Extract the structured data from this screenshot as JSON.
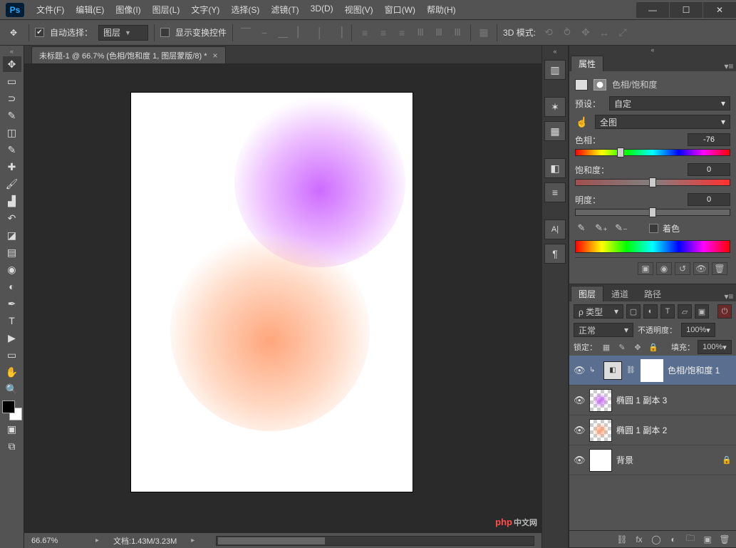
{
  "app": {
    "logo_text": "Ps"
  },
  "menu": {
    "file": "文件(F)",
    "edit": "编辑(E)",
    "image": "图像(I)",
    "layer": "图层(L)",
    "type": "文字(Y)",
    "select": "选择(S)",
    "filter": "滤镜(T)",
    "threeD": "3D(D)",
    "view": "视图(V)",
    "window": "窗口(W)",
    "help": "帮助(H)"
  },
  "options": {
    "auto_select_label": "自动选择：",
    "auto_select_target": "图层",
    "show_transform_label": "显示变换控件",
    "threeD_mode_label": "3D 模式:"
  },
  "document": {
    "tab_title": "未标题-1 @ 66.7% (色相/饱和度 1, 图层蒙版/8) *"
  },
  "status": {
    "zoom": "66.67%",
    "doc_info": "文档:1.43M/3.23M"
  },
  "properties": {
    "tab_label": "属性",
    "adjustment_name": "色相/饱和度",
    "preset_label": "预设：",
    "preset_value": "自定",
    "channel_value": "全图",
    "hue_label": "色相：",
    "hue_value": "-76",
    "sat_label": "饱和度：",
    "sat_value": "0",
    "light_label": "明度：",
    "light_value": "0",
    "colorize_label": "着色"
  },
  "layers_panel": {
    "tab_layers": "图层",
    "tab_channels": "通道",
    "tab_paths": "路径",
    "kind_label": "ρ 类型",
    "blend_mode": "正常",
    "opacity_label": "不透明度：",
    "opacity_value": "100%",
    "lock_label": "锁定：",
    "fill_label": "填充：",
    "fill_value": "100%",
    "layers": [
      {
        "name": "色相/饱和度 1",
        "type": "adjustment",
        "selected": true
      },
      {
        "name": "椭圆 1 副本 3",
        "type": "shape_purple"
      },
      {
        "name": "椭圆 1 副本 2",
        "type": "shape_orange"
      },
      {
        "name": "背景",
        "type": "background",
        "locked": true
      }
    ]
  }
}
